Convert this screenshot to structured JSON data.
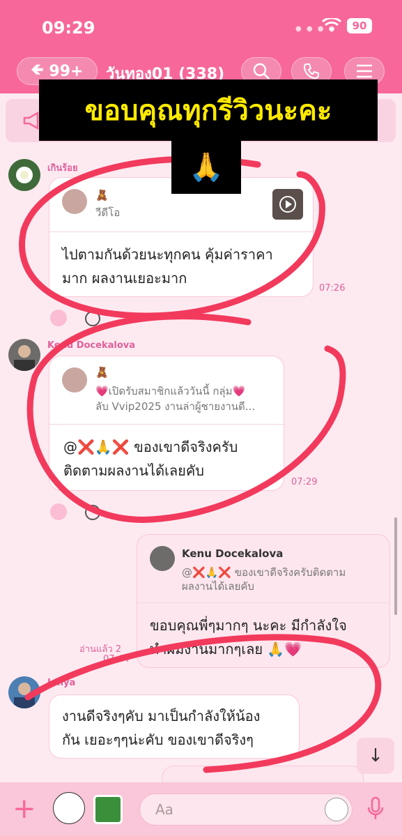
{
  "status_bar": {
    "time": "09:29",
    "battery": "90"
  },
  "header": {
    "back_label": "99+",
    "chat_title": "วันทอง01 (338)"
  },
  "overlay": {
    "caption": "ขอบคุณทุกรีวิวนะคะ",
    "emoji": "🙏"
  },
  "messages": [
    {
      "sender": "เกินร้อย",
      "quote_name": "🧸",
      "quote_text": "วีดีโอ",
      "text_line1": "ไปตามกันด้วยนะทุกคน คุ้มค่าราคา",
      "text_line2": "มาก ผลงานเยอะมาก",
      "time": "07:26"
    },
    {
      "sender": "Kenu Docekalova",
      "quote_name": "🧸",
      "quote_line1": "💗เปิดรับสมาชิกแล้ววันนี้ กลุ่ม💗",
      "quote_line2": "ลับ Vvip2025 งานล่าผู้ชายงานดี...",
      "text_line1": "@❌🙏❌ ของเขาดีจริงครับ",
      "text_line2": "ติดตามผลงานได้เลยคับ",
      "time": "07:29"
    },
    {
      "quote_name": "Kenu Docekalova",
      "quote_line1": "@❌🙏❌ ของเขาดีจริงครับติดตาม",
      "quote_line2": "ผลงานได้เลยคับ",
      "text_line1": "ขอบคุณพี่ๆมากๆ นะคะ มีกำลังใจ",
      "text_line2": "ทำผมงานมากๆเลย 🙏💗",
      "read_label": "อ่านแล้ว 2",
      "time": "07:44"
    },
    {
      "sender": "Jonya",
      "text_line1": "งานดีจริงๆคับ มาเป็นกำลังให้น้อง",
      "text_line2": "กัน เยอะๆๆน่ะคับ ของเขาดีจริงๆ"
    }
  ],
  "composer": {
    "placeholder": "Aa"
  },
  "colors": {
    "brand_pink": "#f7679a",
    "background": "#fdeaf1",
    "scribble_red": "#f23a5d"
  }
}
